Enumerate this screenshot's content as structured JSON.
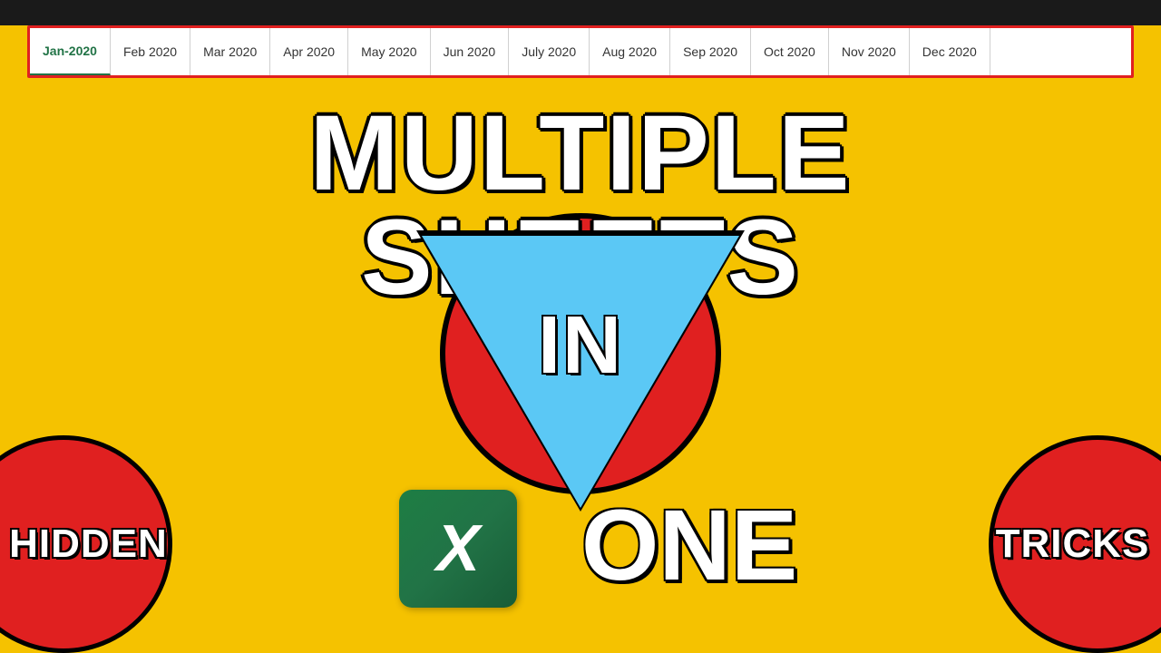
{
  "top_bar": {
    "background": "#1a1a1a"
  },
  "spreadsheet": {
    "tabs": [
      {
        "label": "Jan-2020",
        "active": true
      },
      {
        "label": "Feb 2020",
        "active": false
      },
      {
        "label": "Mar 2020",
        "active": false
      },
      {
        "label": "Apr 2020",
        "active": false
      },
      {
        "label": "May 2020",
        "active": false
      },
      {
        "label": "Jun 2020",
        "active": false
      },
      {
        "label": "July 2020",
        "active": false
      },
      {
        "label": "Aug 2020",
        "active": false
      },
      {
        "label": "Sep 2020",
        "active": false
      },
      {
        "label": "Oct 2020",
        "active": false
      },
      {
        "label": "Nov 2020",
        "active": false
      },
      {
        "label": "Dec 2020",
        "active": false
      }
    ]
  },
  "title": {
    "multiple": "MULTIPLE",
    "sheets": "SHEETS",
    "in": "IN",
    "one": "ONE"
  },
  "badges": {
    "hidden": "HIDDEN",
    "tricks": "TRICKS"
  },
  "excel": {
    "letter": "X"
  }
}
